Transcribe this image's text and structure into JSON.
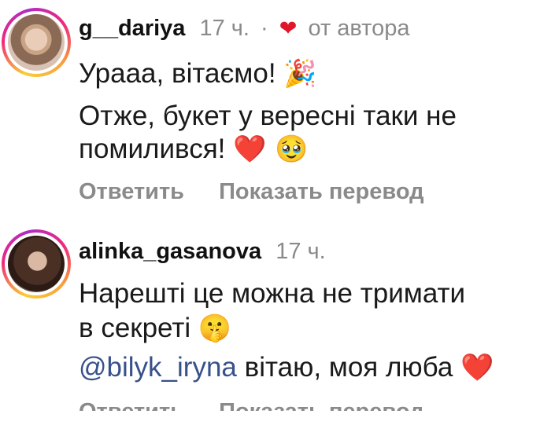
{
  "comments": [
    {
      "username": "g__dariya",
      "time": "17 ч.",
      "separator": "·",
      "author_like": "от автора",
      "lines": [
        {
          "text": "Урааа, вітаємо!",
          "emoji": "🎉"
        },
        {
          "text": "Отже, букет у вересні таки не"
        },
        {
          "text": "помилився!",
          "emoji": "❤️ 🥹"
        }
      ],
      "reply_label": "Ответить",
      "translate_label": "Показать перевод"
    },
    {
      "username": "alinka_gasanova",
      "time": "17 ч.",
      "lines": [
        {
          "text": "Нарешті це можна не тримати"
        },
        {
          "text": "в секреті",
          "emoji": "🤫"
        }
      ],
      "mention": "@bilyk_iryna",
      "mention_text": " вітаю, моя люба",
      "mention_emoji": "❤️",
      "reply_label": "Ответить",
      "translate_label": "Показать перевод"
    }
  ],
  "colors": {
    "accent_heart": "#e0162b",
    "mention": "#38518b",
    "muted": "#8a8a8a"
  }
}
